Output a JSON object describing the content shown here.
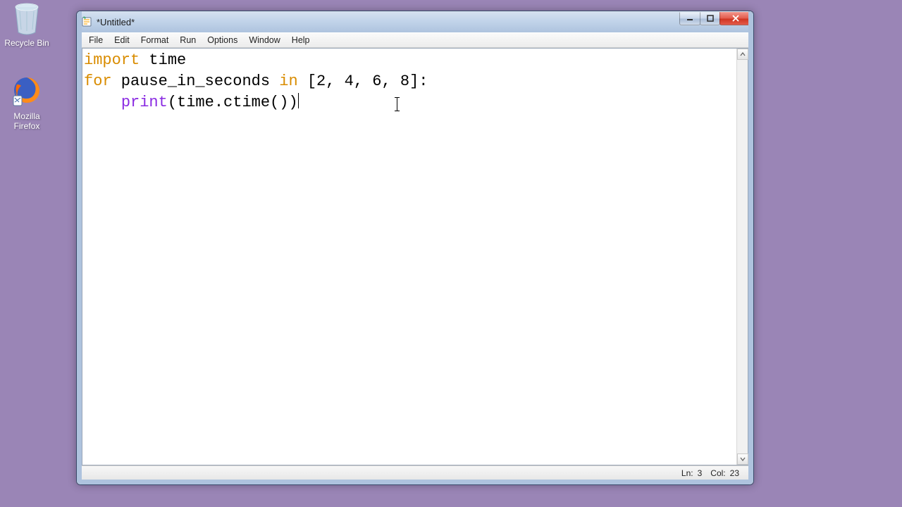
{
  "desktop": {
    "recycle_label": "Recycle Bin",
    "firefox_label_1": "Mozilla",
    "firefox_label_2": "Firefox"
  },
  "window": {
    "title": "*Untitled*",
    "menus": {
      "file": "File",
      "edit": "Edit",
      "format": "Format",
      "run": "Run",
      "options": "Options",
      "window": "Window",
      "help": "Help"
    },
    "status": {
      "ln_label": "Ln:",
      "ln_value": "3",
      "col_label": "Col:",
      "col_value": "23"
    }
  },
  "code": {
    "l1_kw": "import",
    "l1_rest": " time",
    "l2_kw1": "for",
    "l2_mid": " pause_in_seconds ",
    "l2_kw2": "in",
    "l2_rest": " [2, 4, 6, 8]:",
    "l3_indent": "    ",
    "l3_fn": "print",
    "l3_rest": "(time.ctime())"
  }
}
